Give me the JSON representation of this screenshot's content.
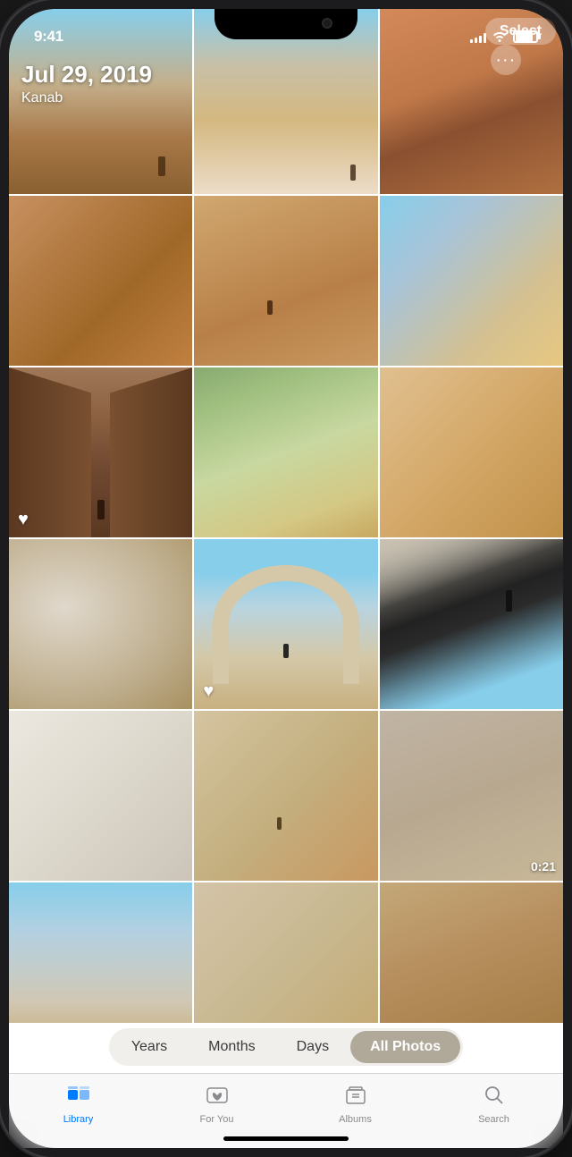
{
  "status_bar": {
    "time": "9:41",
    "signal_bars": [
      4,
      6,
      8,
      10,
      12
    ],
    "battery_level": 80
  },
  "header": {
    "date": "Jul 29, 2019",
    "location": "Kanab",
    "select_label": "Select",
    "more_label": "···"
  },
  "photos": {
    "grid_description": "3-column photo grid of desert/canyon landscape photos"
  },
  "filter_tabs": {
    "pills": [
      "Years",
      "Months",
      "Days",
      "All Photos"
    ],
    "active": "All Photos"
  },
  "tab_bar": {
    "tabs": [
      {
        "id": "library",
        "label": "Library",
        "icon": "photo-stack",
        "active": true
      },
      {
        "id": "for-you",
        "label": "For You",
        "icon": "heart-photo",
        "active": false
      },
      {
        "id": "albums",
        "label": "Albums",
        "icon": "album-stack",
        "active": false
      },
      {
        "id": "search",
        "label": "Search",
        "icon": "magnifying-glass",
        "active": false
      }
    ]
  }
}
